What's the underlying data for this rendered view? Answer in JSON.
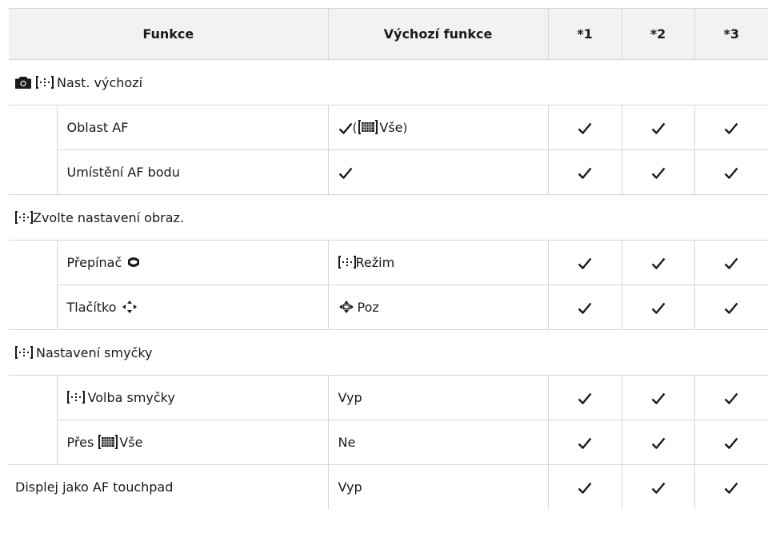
{
  "header": {
    "col_function": "Funkce",
    "col_default": "Výchozí funkce",
    "col_1": "*1",
    "col_2": "*2",
    "col_3": "*3"
  },
  "sections": [
    {
      "title": "Nast. výchozí",
      "rows": [
        {
          "function": "Oblast AF",
          "default_suffix": "Vše",
          "default_open": "(",
          "default_close": ")"
        },
        {
          "function": "Umístění AF bodu"
        }
      ]
    },
    {
      "title": "Zvolte nastavení obraz.",
      "rows": [
        {
          "function": "Přepínač",
          "default": "Režim"
        },
        {
          "function": "Tlačítko",
          "default": "Poz"
        }
      ]
    },
    {
      "title": "Nastavení smyčky",
      "rows": [
        {
          "function": "Volba smyčky",
          "default": "Vyp"
        },
        {
          "function_prefix": "Přes",
          "function_suffix": "Vše",
          "default": "Ne"
        }
      ]
    }
  ],
  "last_row": {
    "function": "Displej jako AF touchpad",
    "default": "Vyp"
  },
  "icons": [
    "camera-icon",
    "af-target-mode-icon",
    "all-target-grid-icon",
    "dial-icon",
    "arrow-pad-icon",
    "checkmark-icon"
  ],
  "colors": {
    "header_bg": "#f2f2f2",
    "border": "#d6d6d6",
    "text": "#1a1a1a"
  }
}
